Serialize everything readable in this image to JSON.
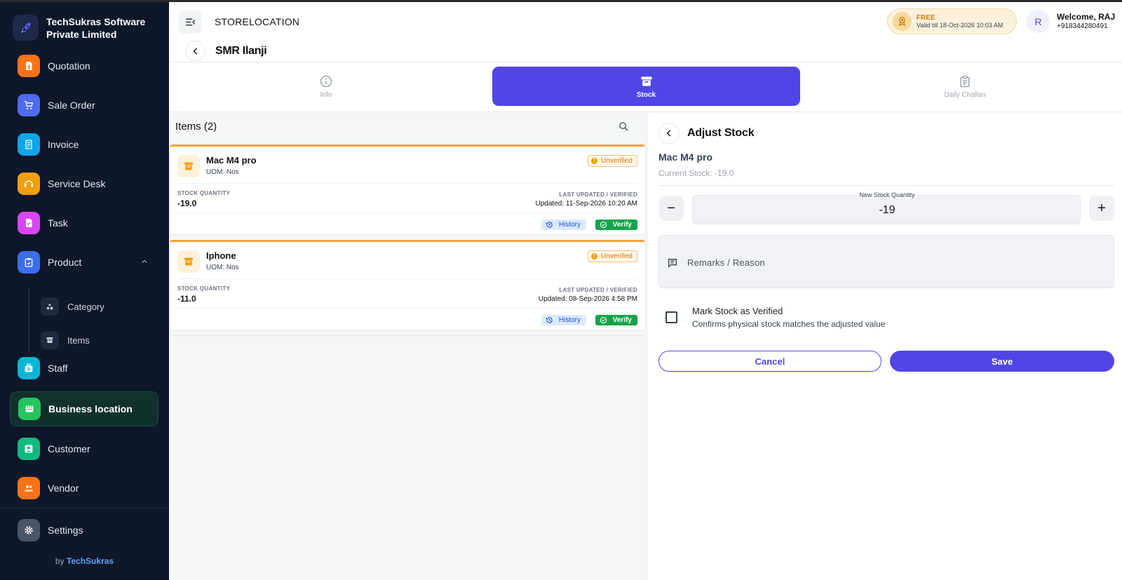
{
  "brand": {
    "name": "TechSukras Software Private Limited"
  },
  "sidebar": {
    "items": [
      {
        "label": "Quotation",
        "color": "#f97316",
        "icon": "quotation-icon"
      },
      {
        "label": "Sale Order",
        "color": "#4f6bf0",
        "icon": "cart-icon"
      },
      {
        "label": "Invoice",
        "color": "#0ea5e9",
        "icon": "invoice-icon"
      },
      {
        "label": "Service Desk",
        "color": "#f59e0b",
        "icon": "headset-icon"
      },
      {
        "label": "Task",
        "color": "#d946ef",
        "icon": "task-icon"
      },
      {
        "label": "Product",
        "color": "#3b6ff0",
        "icon": "product-icon"
      },
      {
        "label": "Staff",
        "color": "#06b6d4",
        "icon": "staff-icon"
      },
      {
        "label": "Business location",
        "color": "#22c55e",
        "icon": "store-icon"
      },
      {
        "label": "Customer",
        "color": "#10b981",
        "icon": "customer-icon"
      },
      {
        "label": "Vendor",
        "color": "#f97316",
        "icon": "vendor-icon"
      },
      {
        "label": "Settings",
        "color": "#475569",
        "icon": "gear-icon"
      }
    ],
    "subitems": [
      {
        "label": "Category",
        "icon": "category-icon"
      },
      {
        "label": "Items",
        "icon": "items-icon"
      }
    ],
    "footer": {
      "prefix": "by",
      "brand": "TechSukras"
    }
  },
  "header": {
    "title": "STORELOCATION",
    "location": "SMR Ilanji",
    "plan": {
      "name": "FREE",
      "valid": "Valid till 18-Oct-2026 10:03 AM"
    },
    "user": {
      "initial": "R",
      "welcome": "Welcome, RAJ",
      "phone": "+918344280491"
    }
  },
  "tabs": [
    {
      "label": "Info",
      "icon": "info-icon"
    },
    {
      "label": "Stock",
      "icon": "box-icon",
      "active": true
    },
    {
      "label": "Daily Challan",
      "icon": "clipboard-icon"
    }
  ],
  "items": {
    "heading": "Items (2)",
    "stock_qty_label": "STOCK QUANTITY",
    "last_updated_label": "LAST UPDATED / VERIFIED",
    "history_label": "History",
    "verify_label": "Verify",
    "list": [
      {
        "name": "Mac M4 pro",
        "uom": "UOM: Nos",
        "status": "Unverified",
        "qty": "-19.0",
        "updated": "Updated: 11-Sep-2026 10:20 AM"
      },
      {
        "name": "Iphone",
        "uom": "UOM: Nos",
        "status": "Unverified",
        "qty": "-11.0",
        "updated": "Updated: 08-Sep-2026 4:58 PM"
      }
    ]
  },
  "adjust": {
    "title": "Adjust Stock",
    "item": "Mac M4 pro",
    "current": "Current Stock: -19.0",
    "qty_label": "New Stock Quantity",
    "qty_value": "-19",
    "minus": "−",
    "plus": "+",
    "remarks_placeholder": "Remarks / Reason",
    "verify_title": "Mark Stock as Verified",
    "verify_sub": "Confirms physical stock matches the adjusted value",
    "cancel": "Cancel",
    "save": "Save"
  },
  "colors": {
    "accent": "#4f46e5",
    "sidebar_bg": "#0f172a",
    "warning": "#f5a13a",
    "success": "#16a34a"
  }
}
